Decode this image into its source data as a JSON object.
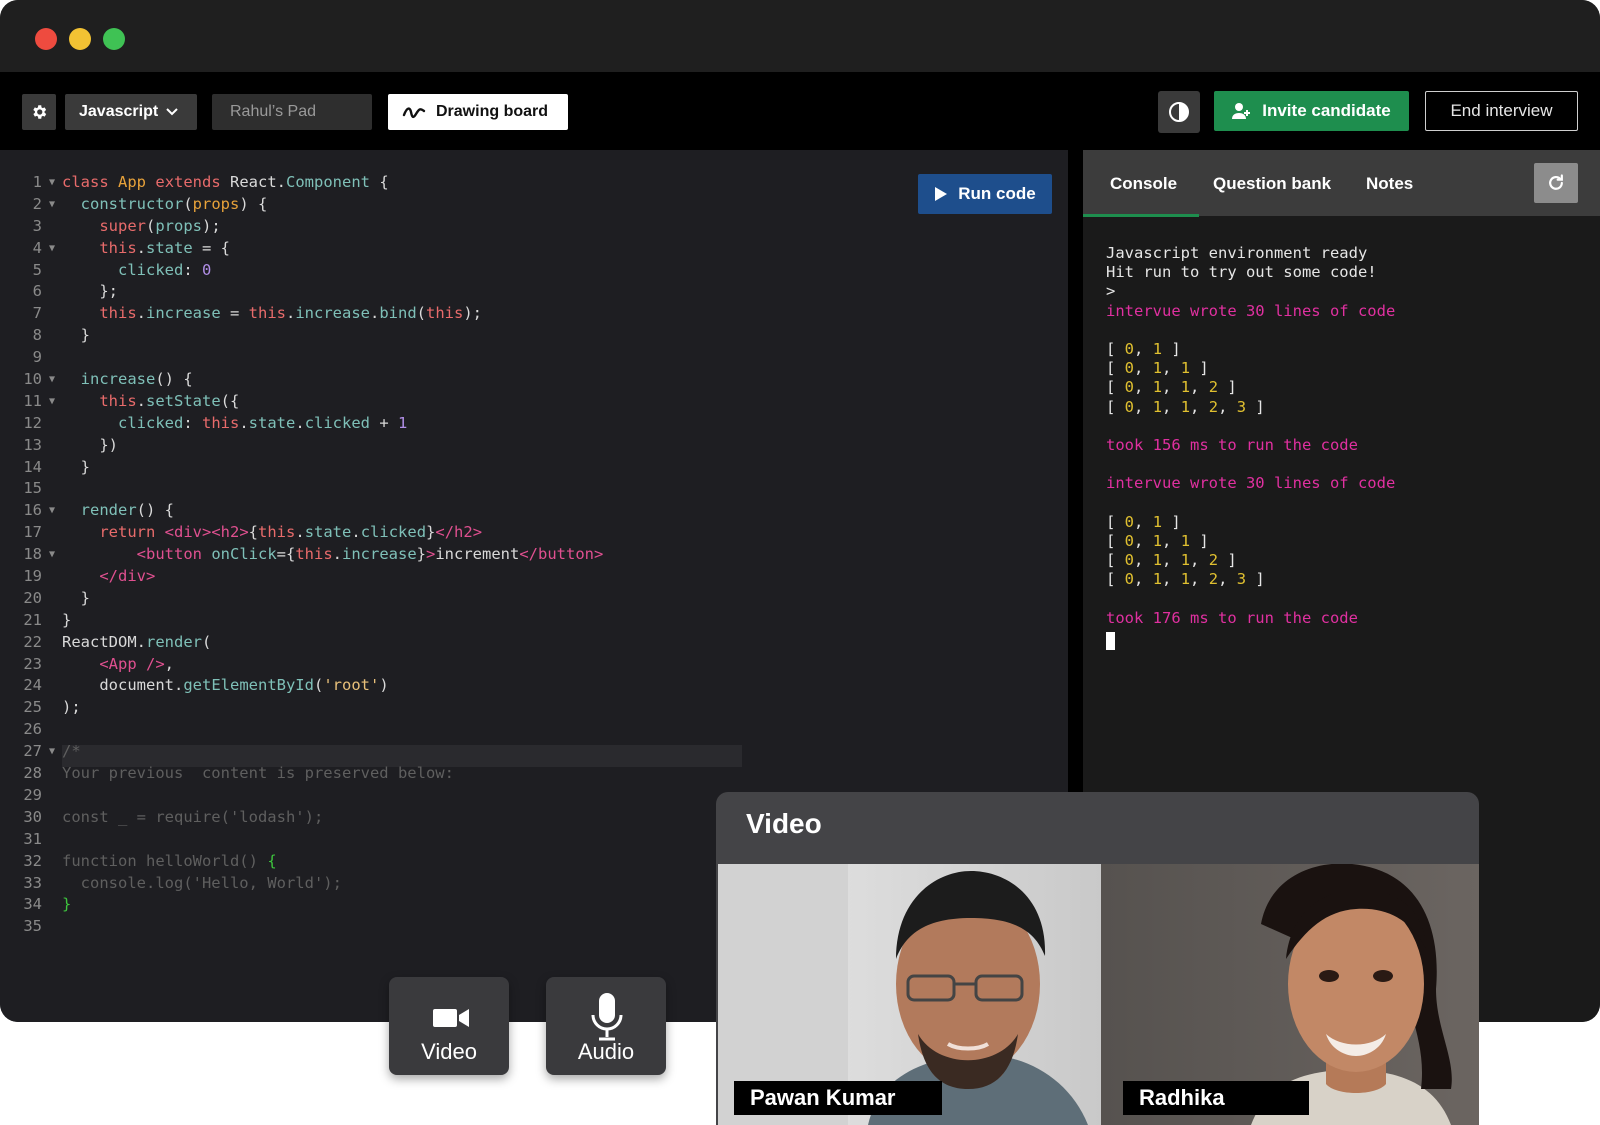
{
  "toolbar": {
    "language": "Javascript",
    "pad_name": "Rahul’s Pad",
    "drawing_board": "Drawing board",
    "invite": "Invite candidate",
    "end": "End interview",
    "run": "Run code"
  },
  "panel": {
    "tabs": [
      "Console",
      "Question bank",
      "Notes"
    ]
  },
  "console": {
    "env_ready": "Javascript environment ready",
    "hint": "Hit run to try out some code!",
    "prompt": ">",
    "wrote": "intervue wrote 30 lines of code",
    "arrays": [
      [
        "0",
        "1"
      ],
      [
        "0",
        "1",
        "1"
      ],
      [
        "0",
        "1",
        "1",
        "2"
      ],
      [
        "0",
        "1",
        "1",
        "2",
        "3"
      ]
    ],
    "took1": "took 156 ms to run the code",
    "took2": "took 176 ms to run the code"
  },
  "video": {
    "title": "Video",
    "participants": [
      "Pawan Kumar",
      "Radhika"
    ],
    "video_label": "Video",
    "audio_label": "Audio"
  },
  "colors": {
    "accent_green": "#1e8e4e",
    "run_blue": "#1e4e8c",
    "console_pink": "#e030a0"
  }
}
